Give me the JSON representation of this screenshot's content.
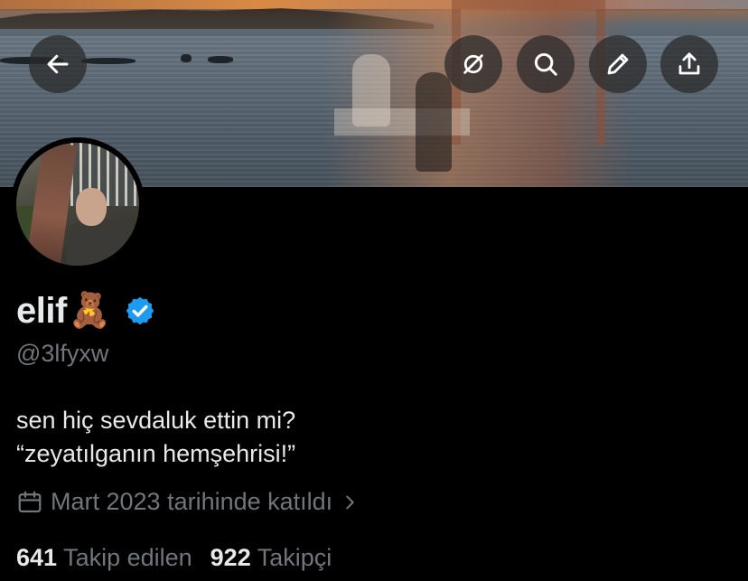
{
  "profile": {
    "display_name": "elif",
    "emoji": "🧸",
    "handle": "@3lfyxw",
    "bio_lines": [
      "sen hiç sevdaluk ettin mi?",
      "“zeyatılganın hemşehrisi!”"
    ],
    "joined": "Mart 2023 tarihinde katıldı",
    "following_count": "641",
    "following_label": "Takip edilen",
    "followers_count": "922",
    "followers_label": "Takipçi"
  },
  "toolbar": {
    "back_icon": "arrow-left-icon",
    "grok_icon": "slashed-circle-icon",
    "search_icon": "search-icon",
    "edit_icon": "pencil-icon",
    "share_icon": "share-upload-icon"
  },
  "colors": {
    "background": "#000000",
    "text_primary": "#e7e9ea",
    "text_secondary": "#71767b",
    "verified": "#1d9bf0"
  }
}
